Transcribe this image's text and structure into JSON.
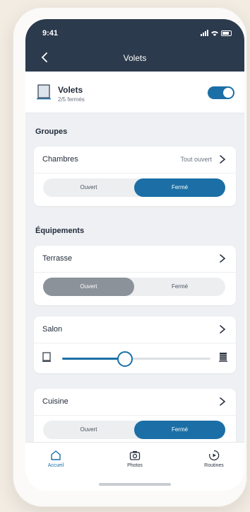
{
  "status_bar": {
    "time": "9:41"
  },
  "nav": {
    "title": "Volets"
  },
  "main_control": {
    "title": "Volets",
    "subtitle": "2/5 fermés",
    "toggle_on": true
  },
  "groups": {
    "section_title": "Groupes",
    "items": [
      {
        "label": "Chambres",
        "state": "Tout ouvert",
        "open_label": "Ouvert",
        "closed_label": "Fermé",
        "selected": "Fermé"
      }
    ]
  },
  "equipments": {
    "section_title": "Équipements",
    "terrasse": {
      "label": "Terrasse",
      "open_label": "Ouvert",
      "closed_label": "Fermé",
      "selected": "Ouvert"
    },
    "salon": {
      "label": "Salon",
      "position_percent": 42
    },
    "cuisine": {
      "label": "Cuisine",
      "open_label": "Ouvert",
      "closed_label": "Fermé",
      "selected": "Fermé"
    }
  },
  "tabbar": {
    "items": [
      {
        "label": "Accueil",
        "icon": "home-icon",
        "active": true
      },
      {
        "label": "Photos",
        "icon": "camera-icon",
        "active": false
      },
      {
        "label": "Routines",
        "icon": "routine-icon",
        "active": false
      }
    ]
  },
  "colors": {
    "accent": "#1b6fa6",
    "header": "#2c3a4d",
    "inactive_segment": "#8c929a"
  }
}
